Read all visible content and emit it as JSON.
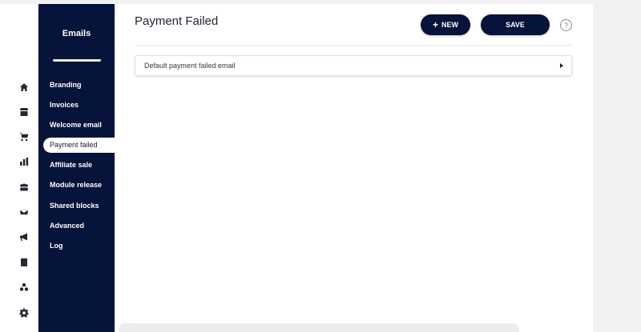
{
  "icon_rail": [
    {
      "icon": "home-icon"
    },
    {
      "icon": "store-icon"
    },
    {
      "icon": "cart-icon"
    },
    {
      "icon": "bar-chart-icon"
    },
    {
      "icon": "people-icon"
    },
    {
      "icon": "mail-icon"
    },
    {
      "icon": "megaphone-icon"
    },
    {
      "icon": "book-icon"
    },
    {
      "icon": "modules-icon"
    },
    {
      "icon": "gear-icon"
    }
  ],
  "sidebar": {
    "title": "Emails",
    "items": [
      {
        "label": "Branding"
      },
      {
        "label": "Invoices"
      },
      {
        "label": "Welcome email"
      },
      {
        "label": "Payment failed",
        "active": true
      },
      {
        "label": "Affiliate sale"
      },
      {
        "label": "Module release"
      },
      {
        "label": "Shared blocks"
      },
      {
        "label": "Advanced"
      },
      {
        "label": "Log"
      }
    ]
  },
  "header": {
    "title": "Payment Failed",
    "new_label": "NEW",
    "save_label": "SAVE",
    "help_label": "?"
  },
  "panel": {
    "label": "Default payment failed email"
  },
  "colors": {
    "navy": "#06133a",
    "background": "#f2f2f2"
  }
}
